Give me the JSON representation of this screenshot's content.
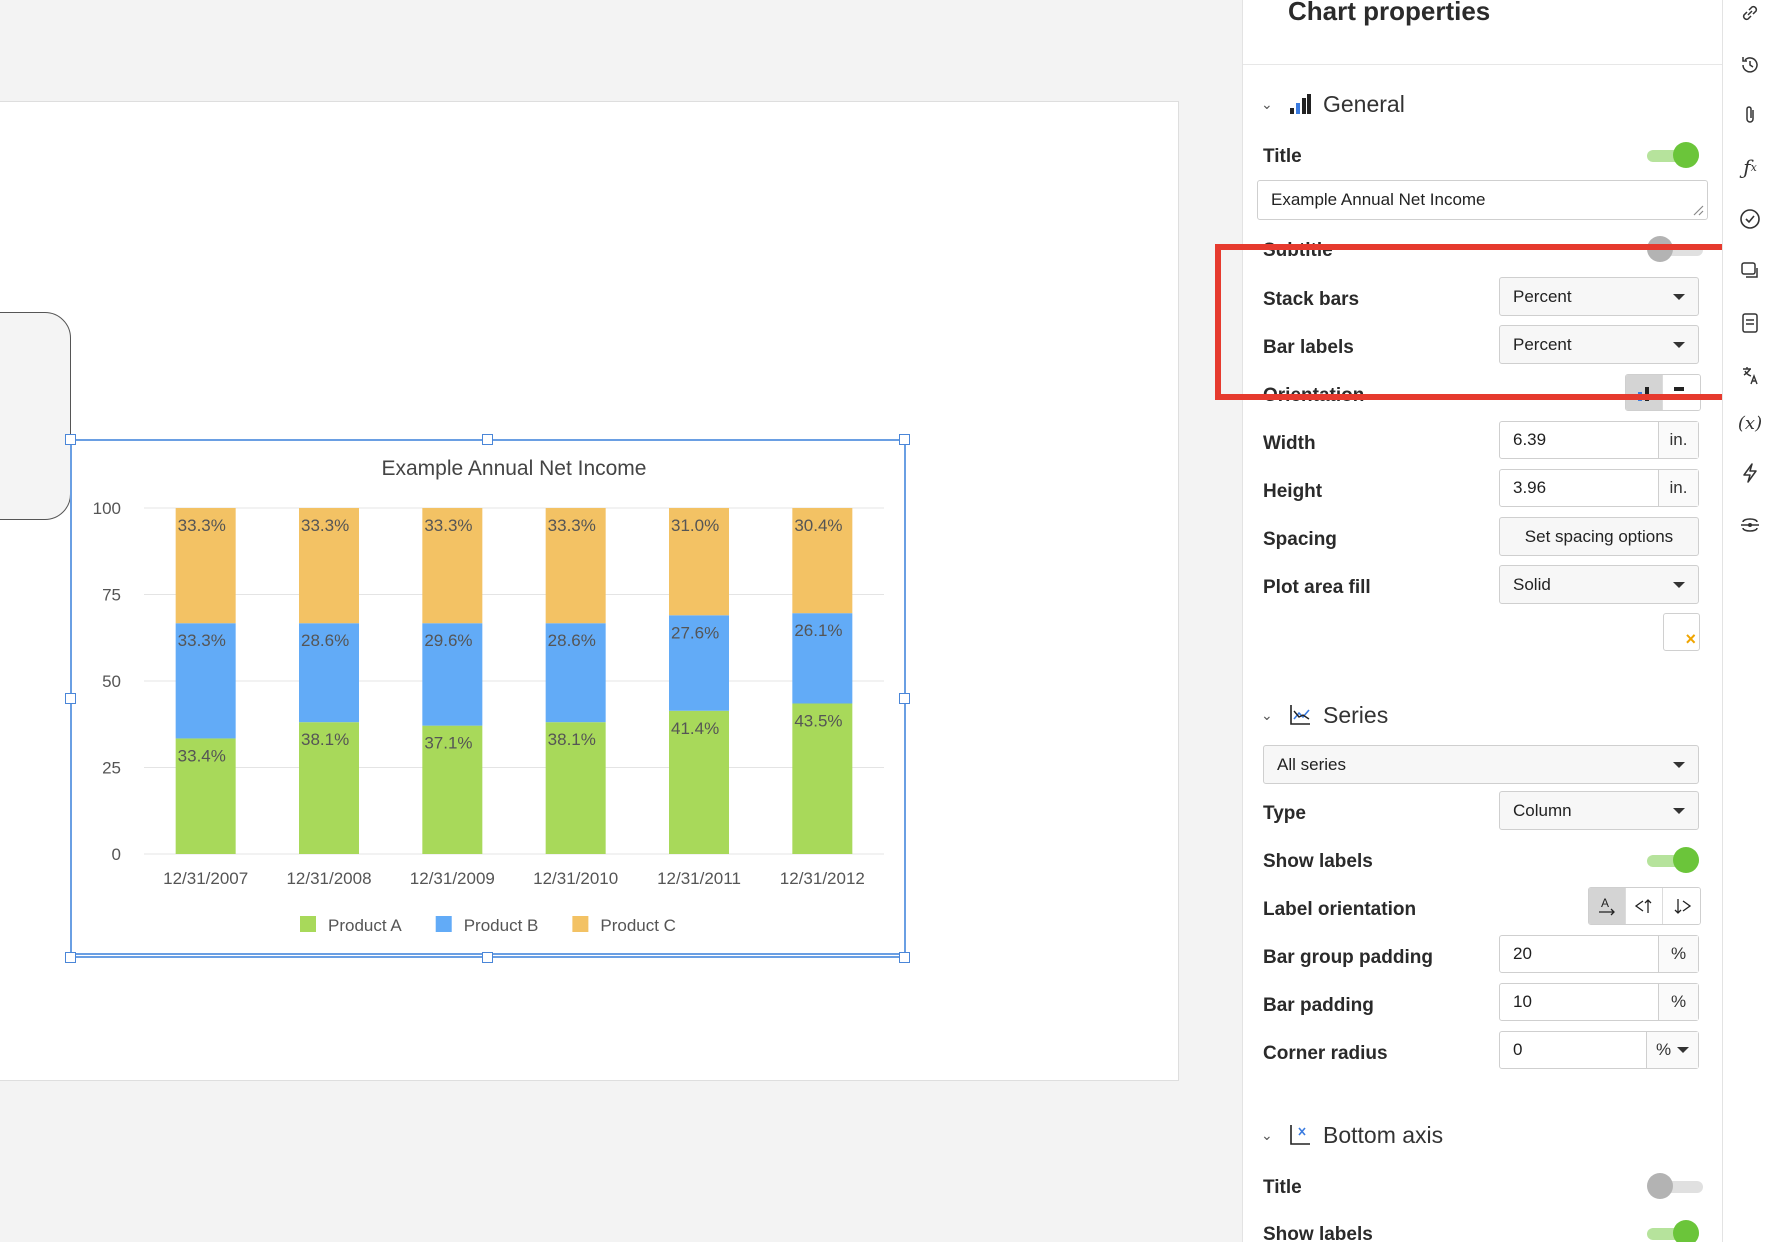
{
  "chart_data": {
    "type": "bar",
    "stacked": "percent",
    "title": "Example Annual Net Income",
    "categories": [
      "12/31/2007",
      "12/31/2008",
      "12/31/2009",
      "12/31/2010",
      "12/31/2011",
      "12/31/2012"
    ],
    "series": [
      {
        "name": "Product A",
        "color": "#a8d95a",
        "values": [
          33.4,
          38.1,
          37.1,
          38.1,
          41.4,
          43.5
        ],
        "labels": [
          "33.4%",
          "38.1%",
          "37.1%",
          "38.1%",
          "41.4%",
          "43.5%"
        ]
      },
      {
        "name": "Product B",
        "color": "#62abf7",
        "values": [
          33.3,
          28.6,
          29.6,
          28.6,
          27.6,
          26.1
        ],
        "labels": [
          "33.3%",
          "28.6%",
          "29.6%",
          "28.6%",
          "27.6%",
          "26.1%"
        ]
      },
      {
        "name": "Product C",
        "color": "#f3c264",
        "values": [
          33.3,
          33.3,
          33.3,
          33.3,
          31.0,
          30.4
        ],
        "labels": [
          "33.3%",
          "33.3%",
          "33.3%",
          "33.3%",
          "31.0%",
          "30.4%"
        ]
      }
    ],
    "yticks": [
      "0",
      "25",
      "50",
      "75",
      "100"
    ],
    "ylim": [
      0,
      100
    ],
    "grid": true,
    "legend": "bottom"
  },
  "panel": {
    "title": "Chart properties",
    "general": {
      "label": "General",
      "title_label": "Title",
      "title_on": true,
      "title_value": "Example Annual Net Income",
      "subtitle_label": "Subtitle",
      "subtitle_on": false,
      "stack_bars_label": "Stack bars",
      "stack_bars_value": "Percent",
      "bar_labels_label": "Bar labels",
      "bar_labels_value": "Percent",
      "orientation_label": "Orientation",
      "width_label": "Width",
      "width_value": "6.39",
      "width_unit": "in.",
      "height_label": "Height",
      "height_value": "3.96",
      "height_unit": "in.",
      "spacing_label": "Spacing",
      "spacing_button": "Set spacing options",
      "plot_fill_label": "Plot area fill",
      "plot_fill_value": "Solid"
    },
    "series": {
      "label": "Series",
      "series_select": "All series",
      "type_label": "Type",
      "type_value": "Column",
      "show_labels_label": "Show labels",
      "show_labels_on": true,
      "label_orientation_label": "Label orientation",
      "bar_group_padding_label": "Bar group padding",
      "bar_group_padding_value": "20",
      "bar_padding_label": "Bar padding",
      "bar_padding_value": "10",
      "corner_radius_label": "Corner radius",
      "corner_radius_value": "0",
      "percent_unit": "%"
    },
    "bottom_axis": {
      "label": "Bottom axis",
      "title_label": "Title",
      "title_on": false,
      "show_labels_label": "Show labels",
      "show_labels_on": true
    }
  },
  "toolbar": {
    "items": [
      "link-icon",
      "history-icon",
      "paperclip-icon",
      "function-icon",
      "check-circle-icon",
      "comments-icon",
      "notes-icon",
      "translate-icon",
      "variable-icon",
      "lightning-icon",
      "integration-icon"
    ]
  }
}
